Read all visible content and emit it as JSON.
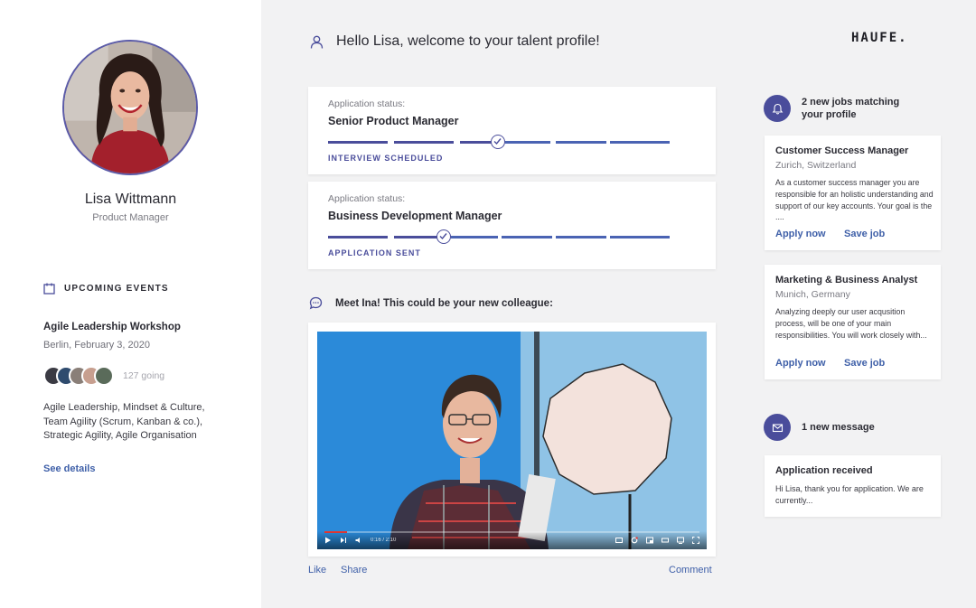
{
  "profile": {
    "name": "Lisa Wittmann",
    "role": "Product Manager"
  },
  "events": {
    "title": "UPCOMING EVENTS",
    "event_name": "Agile Leadership Workshop",
    "event_date": "Berlin, February 3, 2020",
    "going": "127 going",
    "description": "Agile Leadership, Mindset & Culture,\nTeam Agility (Scrum, Kanban & co.),\nStrategic Agility,  Agile Organisation",
    "see_details": "See details"
  },
  "header": {
    "greeting": "Hello Lisa, welcome to your talent profile!",
    "logo": "HAUFE."
  },
  "applications": [
    {
      "label": "Application status:",
      "job": "Senior Product Manager",
      "stage": "INTERVIEW SCHEDULED"
    },
    {
      "label": "Application status:",
      "job": "Business Development Manager",
      "stage": "APPLICATION SENT"
    }
  ],
  "colleague": {
    "title": "Meet Ina! This could be your new colleague:",
    "video_time": "0:16 / 2:10",
    "like": "Like",
    "share": "Share",
    "comment": "Comment"
  },
  "jobs": {
    "notice": "2 new jobs matching your profile",
    "items": [
      {
        "title": "Customer Success Manager",
        "location": "Zurich, Switzerland",
        "description": "As a customer success manager you are responsible for an holistic understanding and support of our key accounts. Your goal is the ....",
        "apply": "Apply now",
        "save": "Save job"
      },
      {
        "title": "Marketing & Business Analyst",
        "location": "Munich, Germany",
        "description": "Analyzing deeply our user acqusition process, will be one of your main responsibilities.  You will work closely with...",
        "apply": "Apply now",
        "save": "Save job"
      }
    ]
  },
  "messages": {
    "notice": "1 new message",
    "title": "Application received",
    "text": "Hi Lisa, thank you for application. We are currently..."
  },
  "colors": {
    "accent": "#4a4d9b",
    "link": "#3e5fa8",
    "background": "#f2f2f3"
  }
}
